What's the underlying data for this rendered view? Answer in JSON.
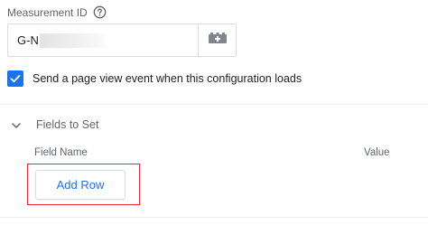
{
  "measurement_id": {
    "label": "Measurement ID",
    "help_icon": "help-circle-icon",
    "value_visible": "G-N",
    "variable_button_icon": "variable-picker-icon"
  },
  "pageview_option": {
    "checked": true,
    "label": "Send a page view event when this configuration loads"
  },
  "fields_section": {
    "title": "Fields to Set",
    "expanded": true,
    "columns": [
      "Field Name",
      "Value"
    ],
    "add_row_label": "Add Row"
  },
  "colors": {
    "accent": "#1a73e8",
    "highlight_border": "#e5283a",
    "muted_text": "#5f6368",
    "border": "#dadce0"
  }
}
